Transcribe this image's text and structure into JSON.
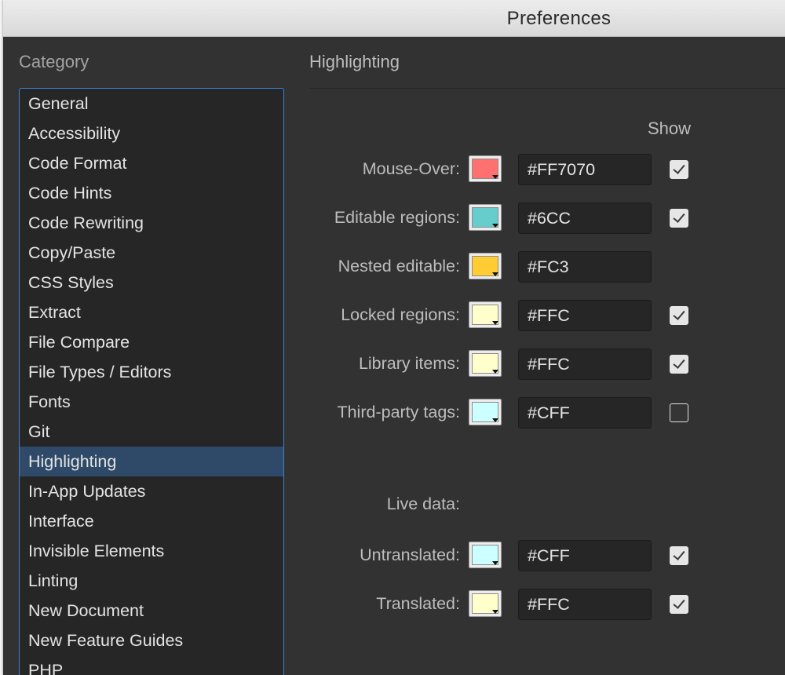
{
  "window": {
    "title": "Preferences"
  },
  "category": {
    "heading": "Category",
    "items": [
      "General",
      "Accessibility",
      "Code Format",
      "Code Hints",
      "Code Rewriting",
      "Copy/Paste",
      "CSS Styles",
      "Extract",
      "File Compare",
      "File Types / Editors",
      "Fonts",
      "Git",
      "Highlighting",
      "In-App Updates",
      "Interface",
      "Invisible Elements",
      "Linting",
      "New Document",
      "New Feature Guides",
      "PHP"
    ],
    "selected": "Highlighting"
  },
  "panel": {
    "title": "Highlighting",
    "show_label": "Show",
    "live_data_label": "Live data:",
    "rows": [
      {
        "label": "Mouse-Over:",
        "color": "#FF7070",
        "hex": "#FF7070",
        "show": true
      },
      {
        "label": "Editable regions:",
        "color": "#66CCCC",
        "hex": "#6CC",
        "show": true
      },
      {
        "label": "Nested editable:",
        "color": "#FFCC33",
        "hex": "#FC3",
        "show": null
      },
      {
        "label": "Locked regions:",
        "color": "#FFFFCC",
        "hex": "#FFC",
        "show": true
      },
      {
        "label": "Library items:",
        "color": "#FFFFCC",
        "hex": "#FFC",
        "show": true
      },
      {
        "label": "Third-party tags:",
        "color": "#CCFFFF",
        "hex": "#CFF",
        "show": false
      }
    ],
    "live_rows": [
      {
        "label": "Untranslated:",
        "color": "#CCFFFF",
        "hex": "#CFF",
        "show": true
      },
      {
        "label": "Translated:",
        "color": "#FFFFCC",
        "hex": "#FFC",
        "show": true
      }
    ]
  }
}
